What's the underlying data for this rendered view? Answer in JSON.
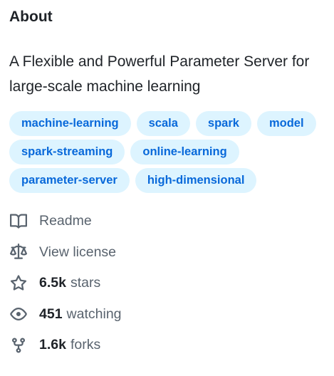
{
  "about": {
    "heading": "About",
    "description": "A Flexible and Powerful Parameter Server for large-scale machine learning",
    "topics": [
      "machine-learning",
      "scala",
      "spark",
      "model",
      "spark-streaming",
      "online-learning",
      "parameter-server",
      "high-dimensional"
    ],
    "readme_label": "Readme",
    "license_label": "View license",
    "stars": {
      "count": "6.5k",
      "label": "stars"
    },
    "watching": {
      "count": "451",
      "label": "watching"
    },
    "forks": {
      "count": "1.6k",
      "label": "forks"
    }
  },
  "icons": {
    "readme": "book-icon",
    "license": "law-icon",
    "stars": "star-icon",
    "watching": "eye-icon",
    "forks": "repo-forked-icon"
  },
  "colors": {
    "topic_bg": "#ddf4ff",
    "topic_text": "#0969da",
    "muted_text": "#59636e",
    "primary_text": "#1f2328"
  }
}
